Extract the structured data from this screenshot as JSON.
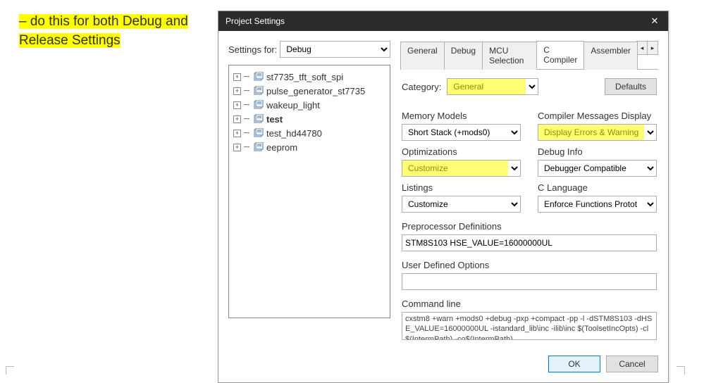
{
  "note": {
    "prefix": "–  ",
    "text": "do this for both Debug and Release Settings"
  },
  "dialog": {
    "title": "Project Settings",
    "close": "✕"
  },
  "left": {
    "settings_for_label": "Settings for:",
    "settings_for_value": "Debug",
    "tree": [
      {
        "label": "st7735_tft_soft_spi",
        "bold": false
      },
      {
        "label": "pulse_generator_st7735",
        "bold": false
      },
      {
        "label": "wakeup_light",
        "bold": false
      },
      {
        "label": "test",
        "bold": true
      },
      {
        "label": "test_hd44780",
        "bold": false
      },
      {
        "label": "eeprom",
        "bold": false
      }
    ]
  },
  "tabs": {
    "items": [
      "General",
      "Debug",
      "MCU Selection",
      "C Compiler",
      "Assembler"
    ],
    "active": 3,
    "left_arrow": "◂",
    "right_arrow": "▸"
  },
  "panel": {
    "category_label": "Category:",
    "category_value": "General",
    "defaults_label": "Defaults",
    "fields": {
      "mem_label": "Memory Models",
      "mem_value": "Short Stack (+mods0)",
      "msg_label": "Compiler Messages Display",
      "msg_value": "Display Errors & Warning",
      "opt_label": "Optimizations",
      "opt_value": "Customize",
      "dbg_label": "Debug Info",
      "dbg_value": "Debugger Compatible",
      "list_label": "Listings",
      "list_value": "Customize",
      "lang_label": "C Language",
      "lang_value": "Enforce Functions Protot",
      "pp_label": "Preprocessor Definitions",
      "pp_value": "STM8S103 HSE_VALUE=16000000UL",
      "ud_label": "User Defined Options",
      "ud_value": "",
      "cmd_label": "Command line",
      "cmd_value": "cxstm8 +warn +mods0 +debug -pxp +compact -pp -l -dSTM8S103 -dHSE_VALUE=16000000UL -istandard_lib\\inc -ilib\\inc $(ToolsetIncOpts) -cl$(IntermPath) -co$(IntermPath)"
    }
  },
  "footer": {
    "ok": "OK",
    "cancel": "Cancel"
  }
}
